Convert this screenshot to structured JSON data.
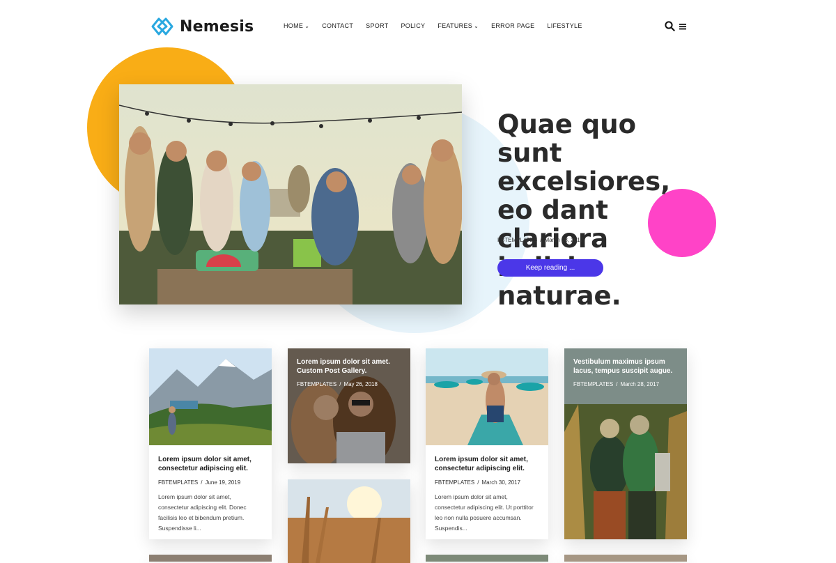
{
  "brand": {
    "name": "Nemesis"
  },
  "nav": [
    {
      "label": "HOME",
      "caret": true
    },
    {
      "label": "CONTACT",
      "caret": false
    },
    {
      "label": "SPORT",
      "caret": false
    },
    {
      "label": "POLICY",
      "caret": false
    },
    {
      "label": "FEATURES",
      "caret": true
    },
    {
      "label": "ERROR PAGE",
      "caret": false
    },
    {
      "label": "LIFESTYLE",
      "caret": false
    }
  ],
  "icons": {
    "search": "search-icon",
    "menu": "hamburger-menu-icon",
    "caret": "chevron-down-icon"
  },
  "hero": {
    "title": "Quae quo sunt excelsiores, eo dant clariora indicia naturae.",
    "author": "FBTEMPLATES",
    "separator": "/",
    "date": "March 08, 2017",
    "button": "Keep reading ..."
  },
  "cards": [
    {
      "title": "Lorem ipsum dolor sit amet, consectetur adipiscing elit.",
      "author": "FBTEMPLATES",
      "separator": "/",
      "date": "June 19, 2019",
      "excerpt": "Lorem ipsum dolor sit amet, consectetur adipiscing elit. Donec facilisis leo et bibendum pretium. Suspendisse li..."
    },
    {
      "title": "Lorem ipsum dolor sit amet. Custom Post Gallery.",
      "author": "FBTEMPLATES",
      "separator": "/",
      "date": "May 26, 2018"
    },
    {
      "title": "Lorem ipsum dolor sit amet, consectetur adipiscing elit.",
      "author": "FBTEMPLATES",
      "separator": "/",
      "date": "March 30, 2017",
      "excerpt": "Lorem ipsum dolor sit amet, consectetur adipiscing elit. Ut porttitor leo non nulla posuere accumsan. Suspendis..."
    },
    {
      "title": "Vestibulum maximus ipsum lacus, tempus suscipit augue.",
      "author": "FBTEMPLATES",
      "separator": "/",
      "date": "March 28, 2017"
    }
  ],
  "colors": {
    "accent": "#4b37e8",
    "orange": "#f9ad16",
    "pink": "#ff43c7",
    "light_blue": "#e7f4fb",
    "logo": "#29a8e0"
  }
}
